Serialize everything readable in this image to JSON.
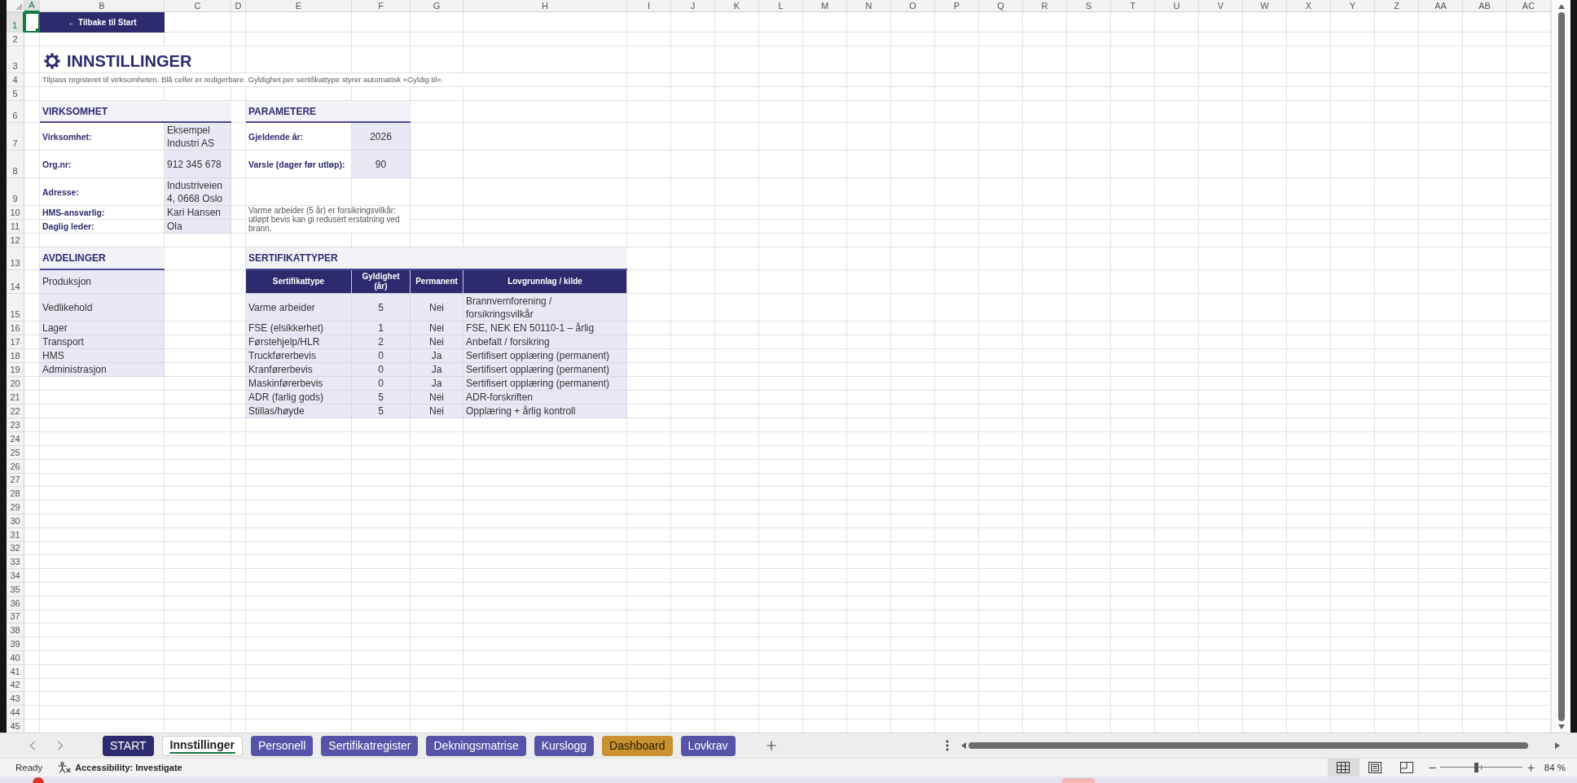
{
  "sheet": {
    "column_headers": [
      {
        "label": "A",
        "selected": true
      },
      {
        "label": "B",
        "selected": false
      },
      {
        "label": "C",
        "selected": false
      },
      {
        "label": "D",
        "selected": false
      },
      {
        "label": "E",
        "selected": false
      },
      {
        "label": "F",
        "selected": false
      },
      {
        "label": "G",
        "selected": false
      },
      {
        "label": "H",
        "selected": false
      },
      {
        "label": "I",
        "selected": false
      },
      {
        "label": "J",
        "selected": false
      },
      {
        "label": "K",
        "selected": false
      },
      {
        "label": "L",
        "selected": false
      },
      {
        "label": "M",
        "selected": false
      },
      {
        "label": "N",
        "selected": false
      },
      {
        "label": "O",
        "selected": false
      },
      {
        "label": "P",
        "selected": false
      },
      {
        "label": "Q",
        "selected": false
      },
      {
        "label": "R",
        "selected": false
      },
      {
        "label": "S",
        "selected": false
      },
      {
        "label": "T",
        "selected": false
      },
      {
        "label": "U",
        "selected": false
      },
      {
        "label": "V",
        "selected": false
      },
      {
        "label": "W",
        "selected": false
      },
      {
        "label": "X",
        "selected": false
      },
      {
        "label": "Y",
        "selected": false
      },
      {
        "label": "Z",
        "selected": false
      },
      {
        "label": "AA",
        "selected": false
      },
      {
        "label": "AB",
        "selected": false
      },
      {
        "label": "AC",
        "selected": false
      }
    ],
    "row_headers": [
      {
        "label": "1",
        "selected": true
      },
      {
        "label": "2",
        "selected": false
      },
      {
        "label": "3",
        "selected": false
      },
      {
        "label": "4",
        "selected": false
      },
      {
        "label": "5",
        "selected": false
      },
      {
        "label": "6",
        "selected": false
      },
      {
        "label": "7",
        "selected": false
      },
      {
        "label": "8",
        "selected": false
      },
      {
        "label": "9",
        "selected": false
      },
      {
        "label": "10",
        "selected": false
      },
      {
        "label": "11",
        "selected": false
      },
      {
        "label": "12",
        "selected": false
      },
      {
        "label": "13",
        "selected": false
      },
      {
        "label": "14",
        "selected": false
      },
      {
        "label": "15",
        "selected": false
      },
      {
        "label": "16",
        "selected": false
      },
      {
        "label": "17",
        "selected": false
      },
      {
        "label": "18",
        "selected": false
      },
      {
        "label": "19",
        "selected": false
      },
      {
        "label": "20",
        "selected": false
      },
      {
        "label": "21",
        "selected": false
      },
      {
        "label": "22",
        "selected": false
      },
      {
        "label": "23",
        "selected": false
      },
      {
        "label": "24",
        "selected": false
      },
      {
        "label": "25",
        "selected": false
      },
      {
        "label": "26",
        "selected": false
      },
      {
        "label": "27",
        "selected": false
      },
      {
        "label": "28",
        "selected": false
      },
      {
        "label": "29",
        "selected": false
      },
      {
        "label": "30",
        "selected": false
      },
      {
        "label": "31",
        "selected": false
      },
      {
        "label": "32",
        "selected": false
      },
      {
        "label": "33",
        "selected": false
      },
      {
        "label": "34",
        "selected": false
      },
      {
        "label": "35",
        "selected": false
      },
      {
        "label": "36",
        "selected": false
      },
      {
        "label": "37",
        "selected": false
      },
      {
        "label": "38",
        "selected": false
      },
      {
        "label": "39",
        "selected": false
      },
      {
        "label": "40",
        "selected": false
      },
      {
        "label": "41",
        "selected": false
      },
      {
        "label": "42",
        "selected": false
      },
      {
        "label": "43",
        "selected": false
      },
      {
        "label": "44",
        "selected": false
      },
      {
        "label": "45",
        "selected": false
      }
    ],
    "back_button": "← Tilbake til Start",
    "title": "INNSTILLINGER",
    "intro": "Tilpass registeret til virksomheten. Blå celler er redigerbare. Gyldighet per sertifikattype styrer automatisk «Gyldig til».",
    "company": {
      "heading": "VIRKSOMHET",
      "fields": [
        {
          "label": "Virksomhet:",
          "value": "Eksempel Industri AS"
        },
        {
          "label": "Org.nr:",
          "value": "912 345 678"
        },
        {
          "label": "Adresse:",
          "value": "Industriveien 4, 0668 Oslo"
        },
        {
          "label": "HMS-ansvarlig:",
          "value": "Kari Hansen"
        },
        {
          "label": "Daglig leder:",
          "value": "Ola"
        }
      ]
    },
    "parameters": {
      "heading": "PARAMETERE",
      "fields": [
        {
          "label": "Gjeldende år:",
          "value": "2026"
        },
        {
          "label": "Varsle (dager før utløp):",
          "value": "90"
        }
      ],
      "note": "Varme arbeider (5 år) er forsikringsvilkår: utløpt bevis kan gi redusert erstatning ved brann."
    },
    "departments": {
      "heading": "AVDELINGER",
      "items": [
        "Produksjon",
        "Vedlikehold",
        "Lager",
        "Transport",
        "HMS",
        "Administrasjon"
      ]
    },
    "certificate_types": {
      "heading": "SERTIFIKATTYPER",
      "columns": [
        "Sertifikattype",
        "Gyldighet (år)",
        "Permanent",
        "Lovgrunnlag / kilde"
      ],
      "rows": [
        [
          "Varme arbeider",
          "5",
          "Nei",
          "Brannvernforening / forsikringsvilkår"
        ],
        [
          "FSE (elsikkerhet)",
          "1",
          "Nei",
          "FSE, NEK EN 50110-1 – årlig"
        ],
        [
          "Førstehjelp/HLR",
          "2",
          "Nei",
          "Anbefalt / forsikring"
        ],
        [
          "Truckførerbevis",
          "0",
          "Ja",
          "Sertifisert opplæring (permanent)"
        ],
        [
          "Kranførerbevis",
          "0",
          "Ja",
          "Sertifisert opplæring (permanent)"
        ],
        [
          "Maskinførerbevis",
          "0",
          "Ja",
          "Sertifisert opplæring (permanent)"
        ],
        [
          "ADR (farlig gods)",
          "5",
          "Nei",
          "ADR-forskriften"
        ],
        [
          "Stillas/høyde",
          "5",
          "Nei",
          "Opplæring + årlig kontroll"
        ]
      ]
    }
  },
  "sheet_tabs": [
    {
      "label": "START",
      "selected": false,
      "color": "#2d2b6d"
    },
    {
      "label": "Innstillinger",
      "selected": true,
      "color": "#1b7a47"
    },
    {
      "label": "Personell",
      "selected": false,
      "color": "#5653a8"
    },
    {
      "label": "Sertifikatregister",
      "selected": false,
      "color": "#5653a8"
    },
    {
      "label": "Dekningsmatrise",
      "selected": false,
      "color": "#5653a8"
    },
    {
      "label": "Kurslogg",
      "selected": false,
      "color": "#5653a8"
    },
    {
      "label": "Dashboard",
      "selected": false,
      "color": "#c99130"
    },
    {
      "label": "Lovkrav",
      "selected": false,
      "color": "#5653a8"
    }
  ],
  "status_bar": {
    "status": "Ready",
    "accessibility": "Accessibility: Investigate",
    "views": [
      {
        "kind": "normal",
        "selected": true
      },
      {
        "kind": "page_layout",
        "selected": false
      },
      {
        "kind": "page_break_preview",
        "selected": false
      }
    ],
    "zoom": {
      "level": 0.44,
      "reading": "84 %"
    }
  }
}
